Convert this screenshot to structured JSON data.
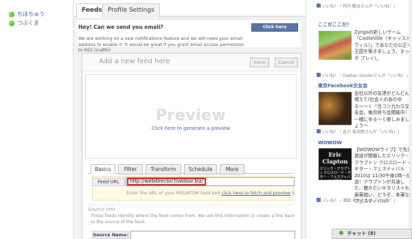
{
  "sidebar": {
    "friends": [
      "ちほちゅう",
      "つぶくま"
    ]
  },
  "tabs": {
    "feeds": "Feeds",
    "profile_settings": "Profile Settings"
  },
  "notice": {
    "heading": "Hey! Can we send you email?",
    "body": "We are working on a new notifications feature and we will need your email address to enable it. It would be great if you grant email access permission to RSS Graffiti!",
    "authorize_button": "Click here authorize"
  },
  "editor": {
    "title": "Add a new feed here",
    "save_label": "Save",
    "cancel_label": "Cancel",
    "preview_title": "Preview",
    "preview_link": "Click here to generate a preview",
    "subtabs": [
      "Basics",
      "Filter",
      "Transform",
      "Schedule",
      "More"
    ],
    "feed_url_label": "Feed URL",
    "feed_url_value": "http://webdirector.livedoor.biz/",
    "hint_prefix": "Enter the URL of your RSS/ATOM feed and",
    "hint_link": "click here to fetch and preview",
    "hint_suffix": "it.",
    "source_info_label": "Source Info",
    "source_info_desc": "These fields identify where the feed comes from. We use this information to create a link back to the source of the feed.",
    "source_name_label": "Source Name:"
  },
  "right": {
    "like_top": "いいね！・竹内 敏治さんが「いいね！」",
    "sec1_title": "ここだここだ！",
    "sec1_text": "Zyngaの新しいゲーム「CastleVille（キャッスルヴィル）」であなたの公正な王国を築きましょう。きっぞ プレイし",
    "sec1_like": "いいね！・Gaetan Sisiokoさんが「いいね！」",
    "sec2_title": "東京Facebook交友会",
    "sec2_text": "会社以外の友達がどんどん増えて(社会人のあのゆる〜〜く『合コン九わな交友会、毎月終ち会開催中！一緒にゆる〜く楽しみましょう〜",
    "sec2_like": "いいね！・吉川 祐次郎さんが「いいね！」",
    "sec3_title": "WOWOW",
    "clapton_name": "Eric Clapton",
    "clapton_sub": "エリック・クラプトン クロスロード・ギター・フェスティバル 2010",
    "sec3_text": "【WOWOWライブ】で先日放送が開催したエリック・クラプトン クロスロード・ギター・フェスティバル 2010は 11/30午後1時～放送！クラプトンが共演した、聴きたいギタリストも豪華揃い、どうぞ、傘華なフェスティバル！",
    "sec3_like": "いいね！・津田 卓也さんが「いいね！」",
    "chat_label": "チャット (8)"
  }
}
